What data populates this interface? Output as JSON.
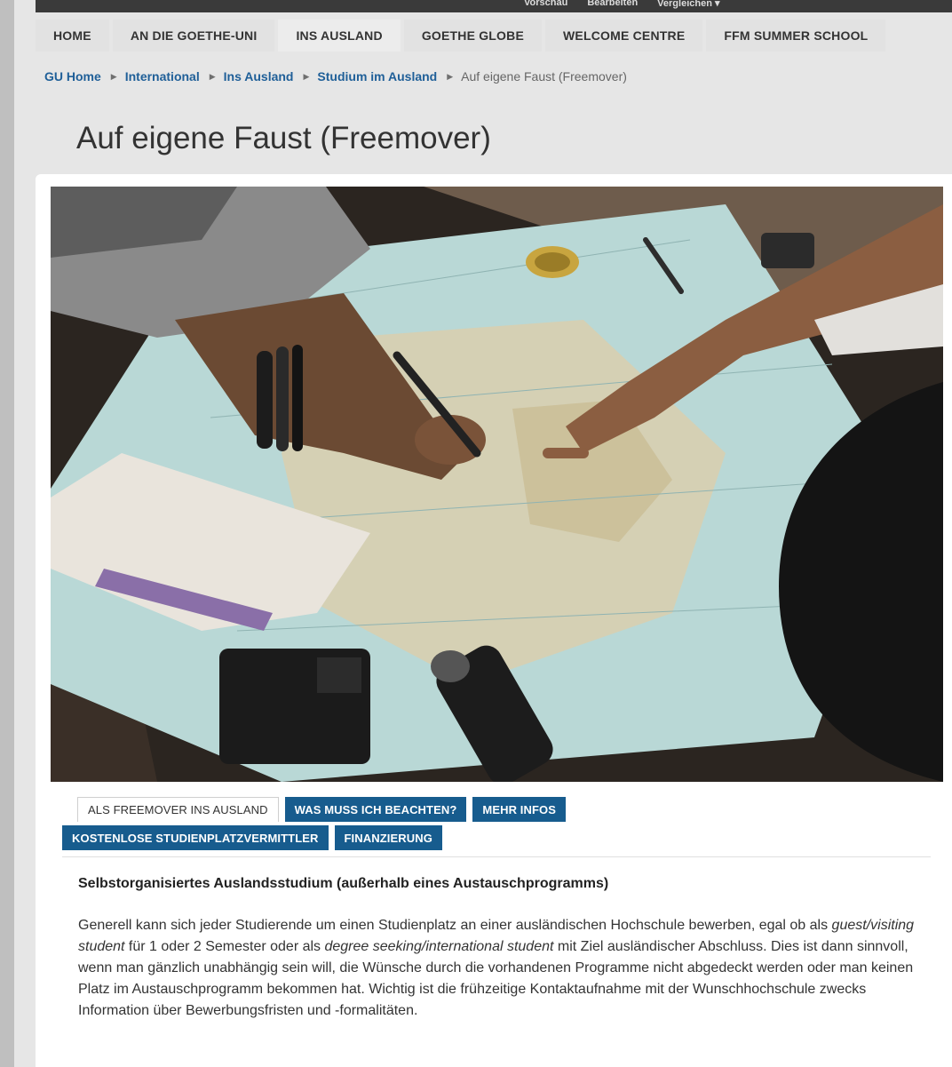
{
  "topbar": {
    "items": [
      "Vorschau",
      "Bearbeiten",
      "Vergleichen ▾"
    ]
  },
  "nav": {
    "tabs": [
      "HOME",
      "AN DIE GOETHE-UNI",
      "INS AUSLAND",
      "GOETHE GLOBE",
      "WELCOME CENTRE",
      "FFM SUMMER SCHOOL"
    ]
  },
  "breadcrumb": {
    "items": [
      "GU Home",
      "International",
      "Ins Ausland",
      "Studium im Ausland"
    ],
    "current": "Auf eigene Faust (Freemover)"
  },
  "page": {
    "title": "Auf eigene Faust (Freemover)"
  },
  "content_tabs": {
    "row1": [
      "ALS FREEMOVER INS AUSLAND",
      "WAS MUSS ICH BEACHTEN?",
      "MEHR INFOS"
    ],
    "row2": [
      "KOSTENLOSE STUDIENPLATZVERMITTLER",
      "FINANZIERUNG"
    ],
    "active": "ALS FREEMOVER INS AUSLAND"
  },
  "section": {
    "heading": "Selbstorganisiertes Auslandsstudium (außerhalb eines Austauschprogramms)",
    "p1": "Generell kann sich jeder Studierende um einen Studienplatz an einer ausländischen Hochschule bewerben, egal ob als ",
    "em1": "guest/visiting student",
    "p2": " für 1 oder 2 Semester oder als ",
    "em2": "degree seeking/international student",
    "p3": " mit Ziel ausländischer Abschluss. Dies ist dann sinnvoll, wenn man gänzlich unabhängig sein will, die Wünsche durch die vorhandenen Programme nicht abgedeckt werden oder man keinen Platz im Austauschprogramm bekommen hat. Wichtig ist die frühzeitige Kontaktaufnahme mit der Wunschhochschule zwecks Information über Bewerbungsfristen und -formalitäten."
  },
  "colors": {
    "tab_blue": "#175c8e",
    "link_blue": "#1f5f98"
  }
}
